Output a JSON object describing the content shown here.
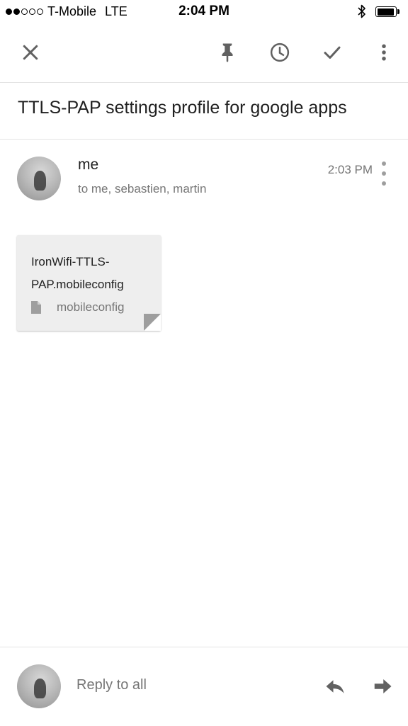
{
  "status_bar": {
    "signal_dots_filled": 2,
    "signal_dots_total": 5,
    "carrier": "T-Mobile",
    "network": "LTE",
    "time": "2:04 PM",
    "bluetooth_icon": "bluetooth-icon",
    "battery_level": 0.95
  },
  "toolbar": {
    "close_icon": "close-icon",
    "pin_icon": "pin-icon",
    "snooze_icon": "clock-icon",
    "done_icon": "check-icon",
    "more_icon": "more-vert-icon"
  },
  "email": {
    "subject": "TTLS-PAP settings profile for google apps",
    "sender": "me",
    "recipients": "to me, sebastien, martin",
    "time": "2:03 PM",
    "attachment": {
      "name": "IronWifi-TTLS-PAP.mobileconfig",
      "type": "mobileconfig",
      "icon": "file-icon"
    }
  },
  "reply": {
    "placeholder": "Reply to all",
    "reply_icon": "reply-icon",
    "forward_icon": "forward-icon"
  },
  "colors": {
    "icon": "#616161",
    "text_primary": "#212121",
    "text_secondary": "#757575",
    "divider": "#e3e3e3",
    "attachment_bg": "#eeeeee",
    "menu_dots": "#9e9e9e"
  }
}
